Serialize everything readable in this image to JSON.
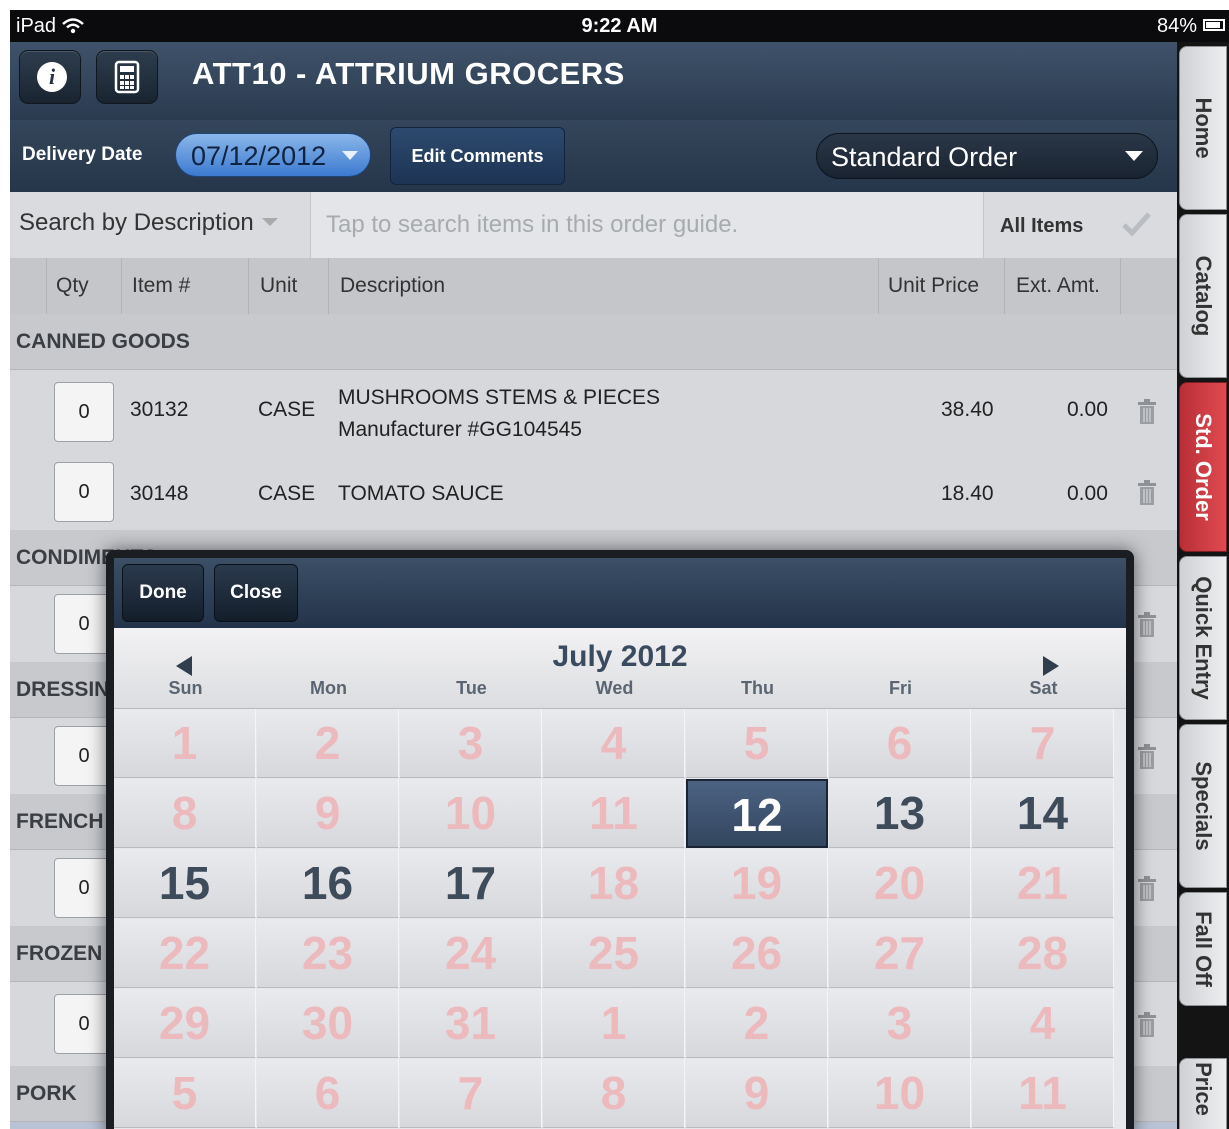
{
  "status_bar": {
    "carrier": "iPad",
    "time": "9:22 AM",
    "battery": "84%"
  },
  "header": {
    "title": "ATT10 - ATTRIUM GROCERS"
  },
  "toolbar": {
    "delivery_label": "Delivery Date",
    "delivery_date": "07/12/2012",
    "edit_comments": "Edit Comments",
    "order_type": "Standard Order"
  },
  "search": {
    "mode": "Search by Description",
    "placeholder": "Tap to search items in this order guide.",
    "filter": "All Items"
  },
  "columns": {
    "qty": "Qty",
    "item": "Item #",
    "unit": "Unit",
    "description": "Description",
    "unit_price": "Unit Price",
    "ext_amt": "Ext. Amt."
  },
  "sections": [
    {
      "name": "CANNED GOODS",
      "items": [
        {
          "qty": "0",
          "item": "30132",
          "unit": "CASE",
          "description": "MUSHROOMS STEMS & PIECES",
          "subtext": "Manufacturer #GG104545",
          "unit_price": "38.40",
          "ext_amt": "0.00"
        },
        {
          "qty": "0",
          "item": "30148",
          "unit": "CASE",
          "description": "TOMATO SAUCE",
          "unit_price": "18.40",
          "ext_amt": "0.00"
        }
      ]
    },
    {
      "name": "CONDIMENTS",
      "items": [
        {
          "qty": "0"
        }
      ]
    },
    {
      "name": "DRESSIN",
      "items": [
        {
          "qty": "0"
        }
      ]
    },
    {
      "name": "FRENCH",
      "items": [
        {
          "qty": "0"
        }
      ]
    },
    {
      "name": "FROZEN",
      "items": [
        {
          "qty": "0"
        }
      ]
    },
    {
      "name": "PORK",
      "items": []
    }
  ],
  "side_tabs": [
    {
      "label": "Home",
      "active": false
    },
    {
      "label": "Catalog",
      "active": false
    },
    {
      "label": "Std. Order",
      "active": true
    },
    {
      "label": "Quick Entry",
      "active": false
    },
    {
      "label": "Specials",
      "active": false
    },
    {
      "label": "Fall Off",
      "active": false
    },
    {
      "label": "Price",
      "active": false
    }
  ],
  "calendar": {
    "done": "Done",
    "close": "Close",
    "month": "July 2012",
    "weekdays": [
      "Sun",
      "Mon",
      "Tue",
      "Wed",
      "Thu",
      "Fri",
      "Sat"
    ],
    "weeks": [
      [
        "1",
        "2",
        "3",
        "4",
        "5",
        "6",
        "7"
      ],
      [
        "8",
        "9",
        "10",
        "11",
        "12",
        "13",
        "14"
      ],
      [
        "15",
        "16",
        "17",
        "18",
        "19",
        "20",
        "21"
      ],
      [
        "22",
        "23",
        "24",
        "25",
        "26",
        "27",
        "28"
      ],
      [
        "29",
        "30",
        "31",
        "1",
        "2",
        "3",
        "4"
      ],
      [
        "5",
        "6",
        "7",
        "8",
        "9",
        "10",
        "11"
      ]
    ],
    "selectable": [
      "12",
      "13",
      "14",
      "15",
      "16",
      "17"
    ],
    "selected": "12",
    "colors": {
      "unavailable": "#ecb9bd",
      "available": "#3e4b5a",
      "selected_bg": "#3d5170"
    }
  }
}
